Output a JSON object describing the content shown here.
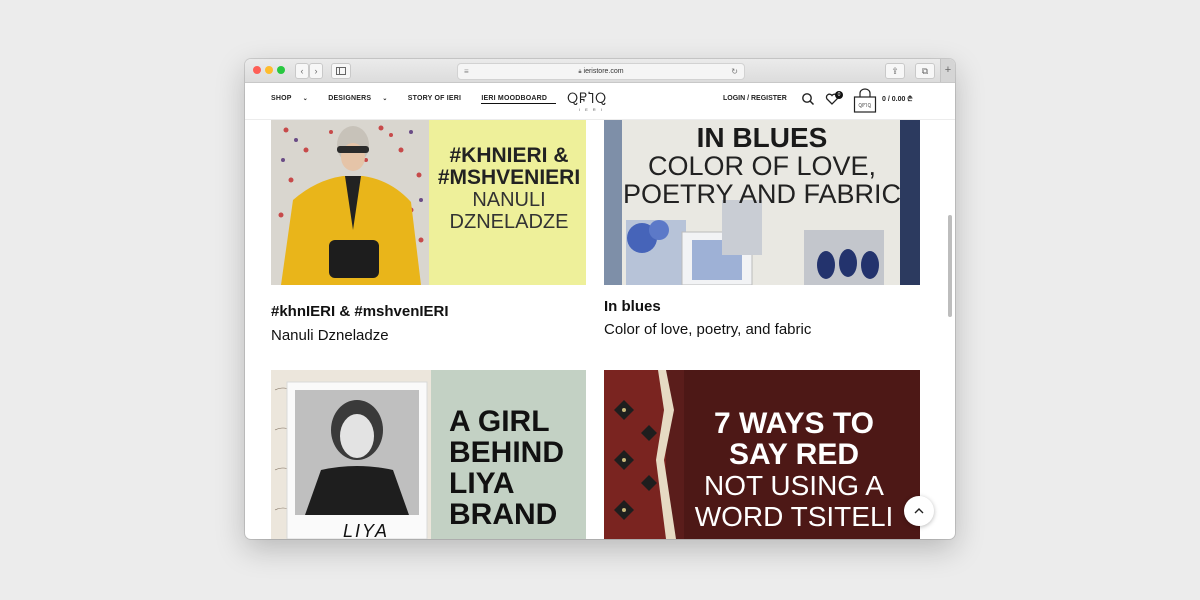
{
  "browser": {
    "url": "ieristore.com"
  },
  "header": {
    "nav": [
      {
        "label": "SHOP",
        "dropdown": true
      },
      {
        "label": "DESIGNERS",
        "dropdown": true
      },
      {
        "label": "STORY OF IERI",
        "dropdown": false
      },
      {
        "label": "IERI MOODBOARD",
        "dropdown": false,
        "active": true
      }
    ],
    "logo": "ႭႼႨႭ",
    "logo_sub": "IERI",
    "login": "LOGIN / REGISTER",
    "wishlist_count": "0",
    "cart_bag_text": "ႭႼႨႭ",
    "cart_total": "0 / 0.00 ₾"
  },
  "posts": [
    {
      "image_text": [
        "#KHNIERI &",
        "#MSHVENIERI",
        "NANULI",
        "DZNELADZE"
      ],
      "title": "#khnIERI & #mshvenIERI",
      "subtitle": "Nanuli Dzneladze"
    },
    {
      "image_text": [
        "IN BLUES",
        "COLOR OF LOVE,",
        "POETRY AND FABRIC"
      ],
      "title": "In blues",
      "subtitle": "Color of love, poetry, and fabric"
    },
    {
      "image_text": [
        "A GIRL",
        "BEHIND",
        "LIYA",
        "BRAND"
      ],
      "photo_caption": "LIYA"
    },
    {
      "image_text": [
        "7 WAYS TO",
        "SAY RED",
        "NOT USING A",
        "WORD TSITELI"
      ]
    }
  ],
  "colors": {
    "yellow_panel": "#eef09a",
    "sage_panel": "#c3d1c4",
    "red_panel": "#5c1f1c"
  }
}
